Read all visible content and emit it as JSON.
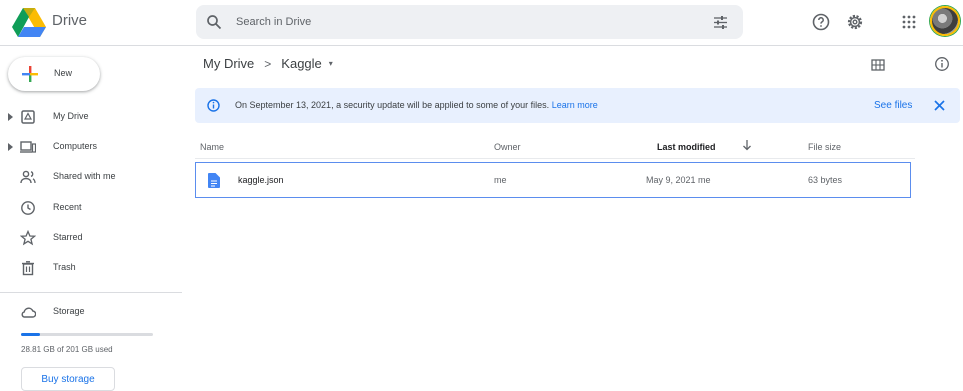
{
  "header": {
    "app_name": "Drive",
    "search_placeholder": "Search in Drive",
    "icons": [
      "drive-logo",
      "search-icon",
      "search-options-icon",
      "help-icon",
      "settings-icon",
      "apps-grid-icon",
      "avatar"
    ]
  },
  "sidebar": {
    "new_label": "New",
    "items": [
      {
        "label": "My Drive",
        "icon": "my-drive-icon",
        "expandable": true
      },
      {
        "label": "Computers",
        "icon": "computers-icon",
        "expandable": true
      },
      {
        "label": "Shared with me",
        "icon": "shared-icon",
        "expandable": false
      },
      {
        "label": "Recent",
        "icon": "clock-icon",
        "expandable": false
      },
      {
        "label": "Starred",
        "icon": "star-icon",
        "expandable": false
      },
      {
        "label": "Trash",
        "icon": "trash-icon",
        "expandable": false
      },
      {
        "label": "Storage",
        "icon": "cloud-icon",
        "expandable": false
      }
    ],
    "storage": {
      "used_text": "28.81 GB of 201 GB used",
      "used_fraction": 0.143,
      "buy_label": "Buy storage"
    }
  },
  "main": {
    "breadcrumb": {
      "root": "My Drive",
      "separator": ">",
      "current": "Kaggle",
      "caret": "▾"
    },
    "banner": {
      "text": "On September 13, 2021, a security update will be applied to some of your files.",
      "link": "Learn more",
      "action": "See files"
    },
    "columns": {
      "name": "Name",
      "owner": "Owner",
      "modified": "Last modified",
      "size": "File size"
    },
    "rows": [
      {
        "name": "kaggle.json",
        "owner": "me",
        "modified": "May 9, 2021 me",
        "size": "63 bytes"
      }
    ]
  },
  "colors": {
    "accent": "#1a73e8",
    "banner_bg": "#e8f0fe",
    "selected_border": "#5b8dee"
  }
}
